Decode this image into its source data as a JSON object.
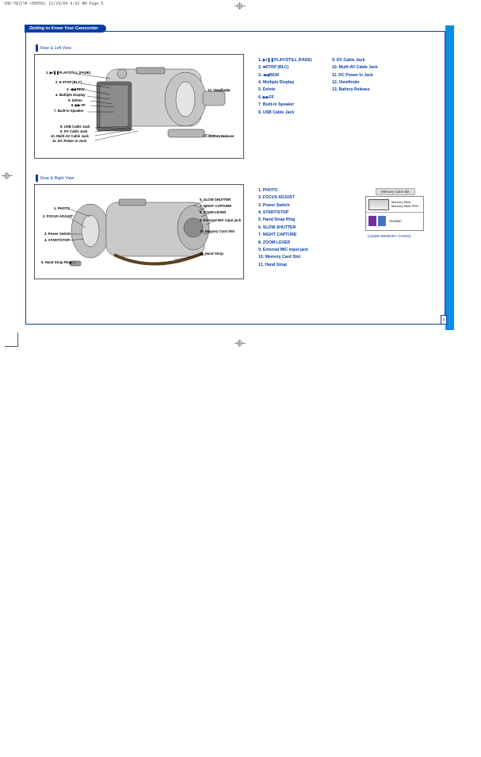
{
  "meta_header": "~EW:*8∏î*# (06059)  11/19/04 9:42 AM  Page 5",
  "page_number": "5",
  "section_title": "Getting to Know Your Camcorder",
  "rear_left": {
    "heading": "Rear & Left View",
    "callouts": {
      "c1": "1. ▶/❚❚PLAY/STILL (FADE)",
      "c2": "2. ■ STOP (BLC)",
      "c3": "3. ◀◀ REW",
      "c4": "4.    Multiple Display",
      "c5": "5.    Delete",
      "c6": "6. ▶▶ FF",
      "c7": "7. Built-in Speaker",
      "c8": "8. USB Cable Jack",
      "c9": "9. DV Cable Jack",
      "c10": "10. Multi-AV Cable Jack",
      "c11": "11. DC Power In Jack",
      "c12": "12. Viewfinder",
      "c13": "13. Battery Release"
    },
    "legend_a": [
      "1. ▶/❚❚PLAY/STILL (FADE)",
      "2. ■STOP (BLC)",
      "3. ◀◀REW",
      "4.   Multiple Display",
      "5.    Delete",
      "6. ▶▶FF",
      "7. Built-in Speaker",
      "8. USB Cable Jack"
    ],
    "legend_b": [
      "9. DV Cable Jack",
      "10. Multi-AV Cable Jack",
      "11. DC Power In Jack",
      "12. Viewfinder",
      "13. Battery Release"
    ]
  },
  "rear_right": {
    "heading": "Rear & Right View",
    "callouts": {
      "c1": "1. PHOTO",
      "c2": "2. FOCUS ADJUST",
      "c3": "3. Power Switch",
      "c4": "4. START/STOP",
      "c5": "5. Hand Strap Ring",
      "c6": "6. SLOW SHUTTER",
      "c7": "7. NIGHT CAPTURE",
      "c8": "8. ZOOM LEVER",
      "c9": "9. External MIC input jack",
      "c10": "10. Memory Card Slot",
      "c11": "11. Hand Strap"
    },
    "legend": [
      "1. PHOTO",
      "2. FOCUS ADJUST",
      "3. Power Switch",
      "4. START/STOP",
      "5. Hand Strap Ring",
      "6. SLOW SHUTTER",
      "7. NIGHT CAPTURE",
      "8. ZOOM LEVER",
      "9. External MIC input jack",
      "10. Memory Card Slot",
      "11. Hand Strap"
    ]
  },
  "memory_card": {
    "title": "Memory Card slot",
    "row1a": "Memory Stick",
    "row1b": "Memory Stick PRO",
    "row2": "SD/MMC",
    "note": "(Usable MEMORY CARDs)"
  }
}
